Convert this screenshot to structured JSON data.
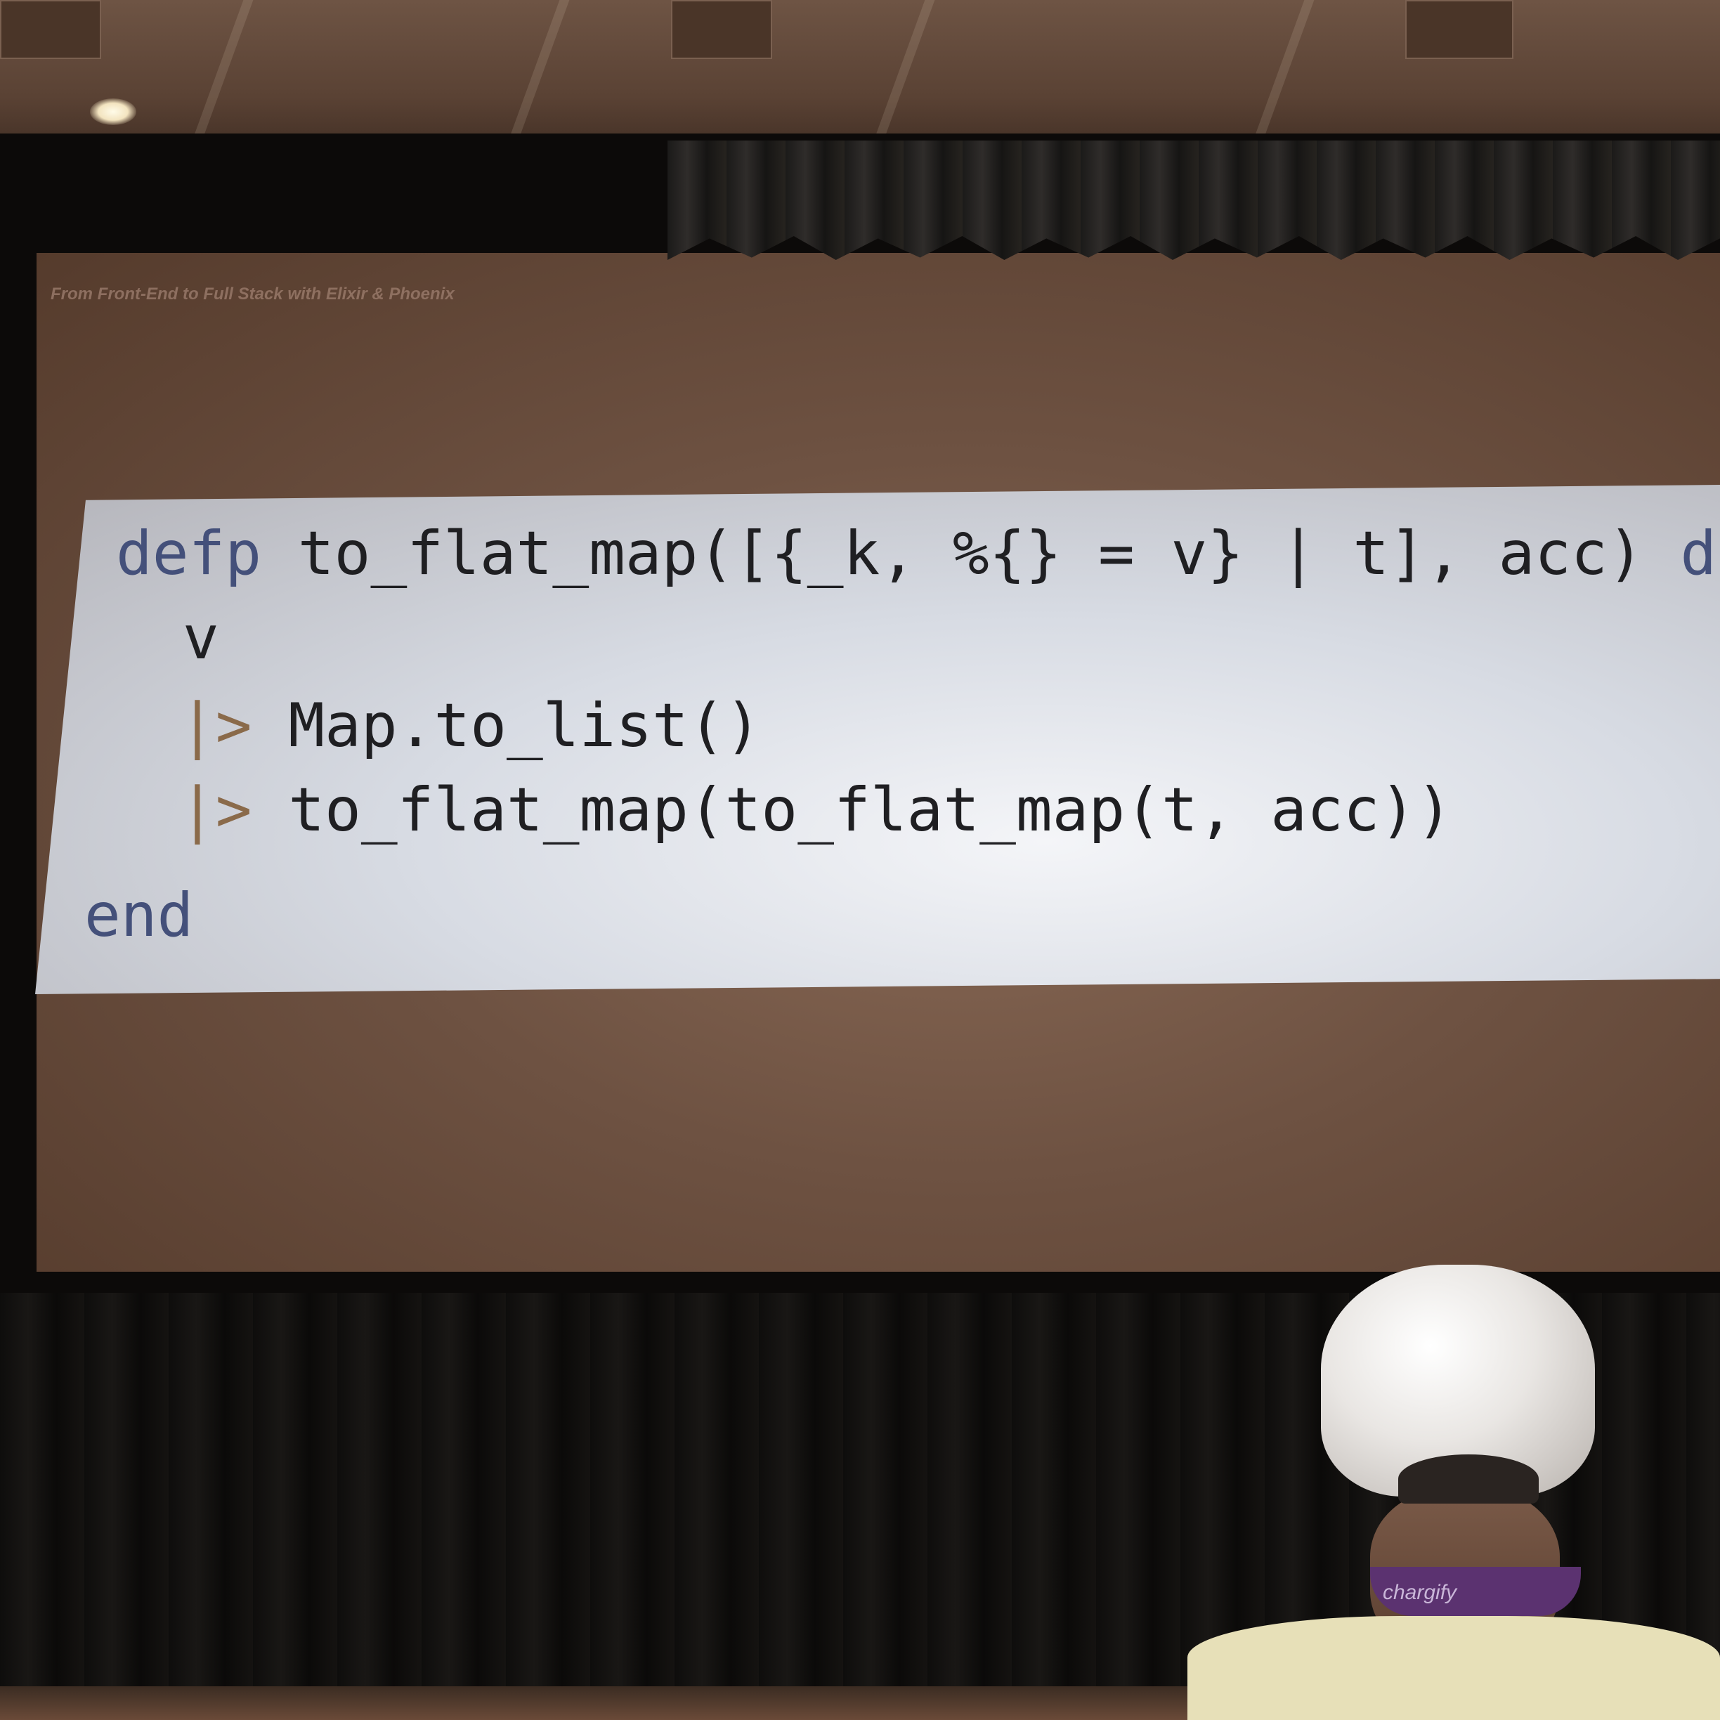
{
  "slide": {
    "header": "From Front-End to Full Stack with Elixir & Phoenix",
    "code_lines": [
      {
        "indent": 0,
        "parts": [
          {
            "t": "defp",
            "k": "kw"
          },
          {
            "t": " to_flat_map([{_k, %{} = v} | t], acc) ",
            "k": "code"
          },
          {
            "t": "do",
            "k": "kw"
          }
        ]
      },
      {
        "indent": 1,
        "parts": [
          {
            "t": "v",
            "k": "code"
          }
        ]
      },
      {
        "indent": 1,
        "parts": [
          {
            "t": "|>",
            "k": "op"
          },
          {
            "t": " Map.to_list()",
            "k": "code"
          }
        ]
      },
      {
        "indent": 1,
        "parts": [
          {
            "t": "|>",
            "k": "op"
          },
          {
            "t": " to_flat_map(to_flat_map(t, acc))",
            "k": "code"
          }
        ]
      },
      {
        "indent": 0,
        "parts": [
          {
            "t": "end",
            "k": "kw"
          }
        ]
      }
    ]
  },
  "lanyard": {
    "text": "chargify"
  },
  "colors": {
    "keyword": "#44507a",
    "code": "#1f1f22",
    "operator": "#8a6a4a",
    "panel": "#e8eaef"
  }
}
